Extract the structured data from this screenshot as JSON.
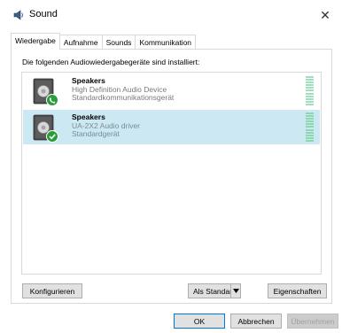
{
  "window": {
    "title": "Sound",
    "icon": "speaker-icon",
    "close_glyph": "✕"
  },
  "tabs": [
    {
      "label": "Wiedergabe",
      "active": true
    },
    {
      "label": "Aufnahme",
      "active": false
    },
    {
      "label": "Sounds",
      "active": false
    },
    {
      "label": "Kommunikation",
      "active": false
    }
  ],
  "panel": {
    "instructions": "Die folgenden Audiowiedergabegeräte sind installiert:"
  },
  "devices": [
    {
      "name": "Speakers",
      "description": "High Definition Audio Device",
      "status": "Standardkommunikationsgerät",
      "badge_icon": "phone-icon",
      "badge_color": "#2a9d3a",
      "selected": false
    },
    {
      "name": "Speakers",
      "description": "UA-2X2 Audio driver",
      "status": "Standardgerät",
      "badge_icon": "check-icon",
      "badge_color": "#2a9d3a",
      "selected": true
    }
  ],
  "buttons": {
    "configure": "Konfigurieren",
    "set_default": "Als Standard",
    "properties": "Eigenschaften",
    "ok": "OK",
    "cancel": "Abbrechen",
    "apply": "Übernehmen"
  },
  "colors": {
    "selection": "#cce8f3",
    "meter": "#9fe0bf",
    "focus_border": "#0078d7"
  }
}
